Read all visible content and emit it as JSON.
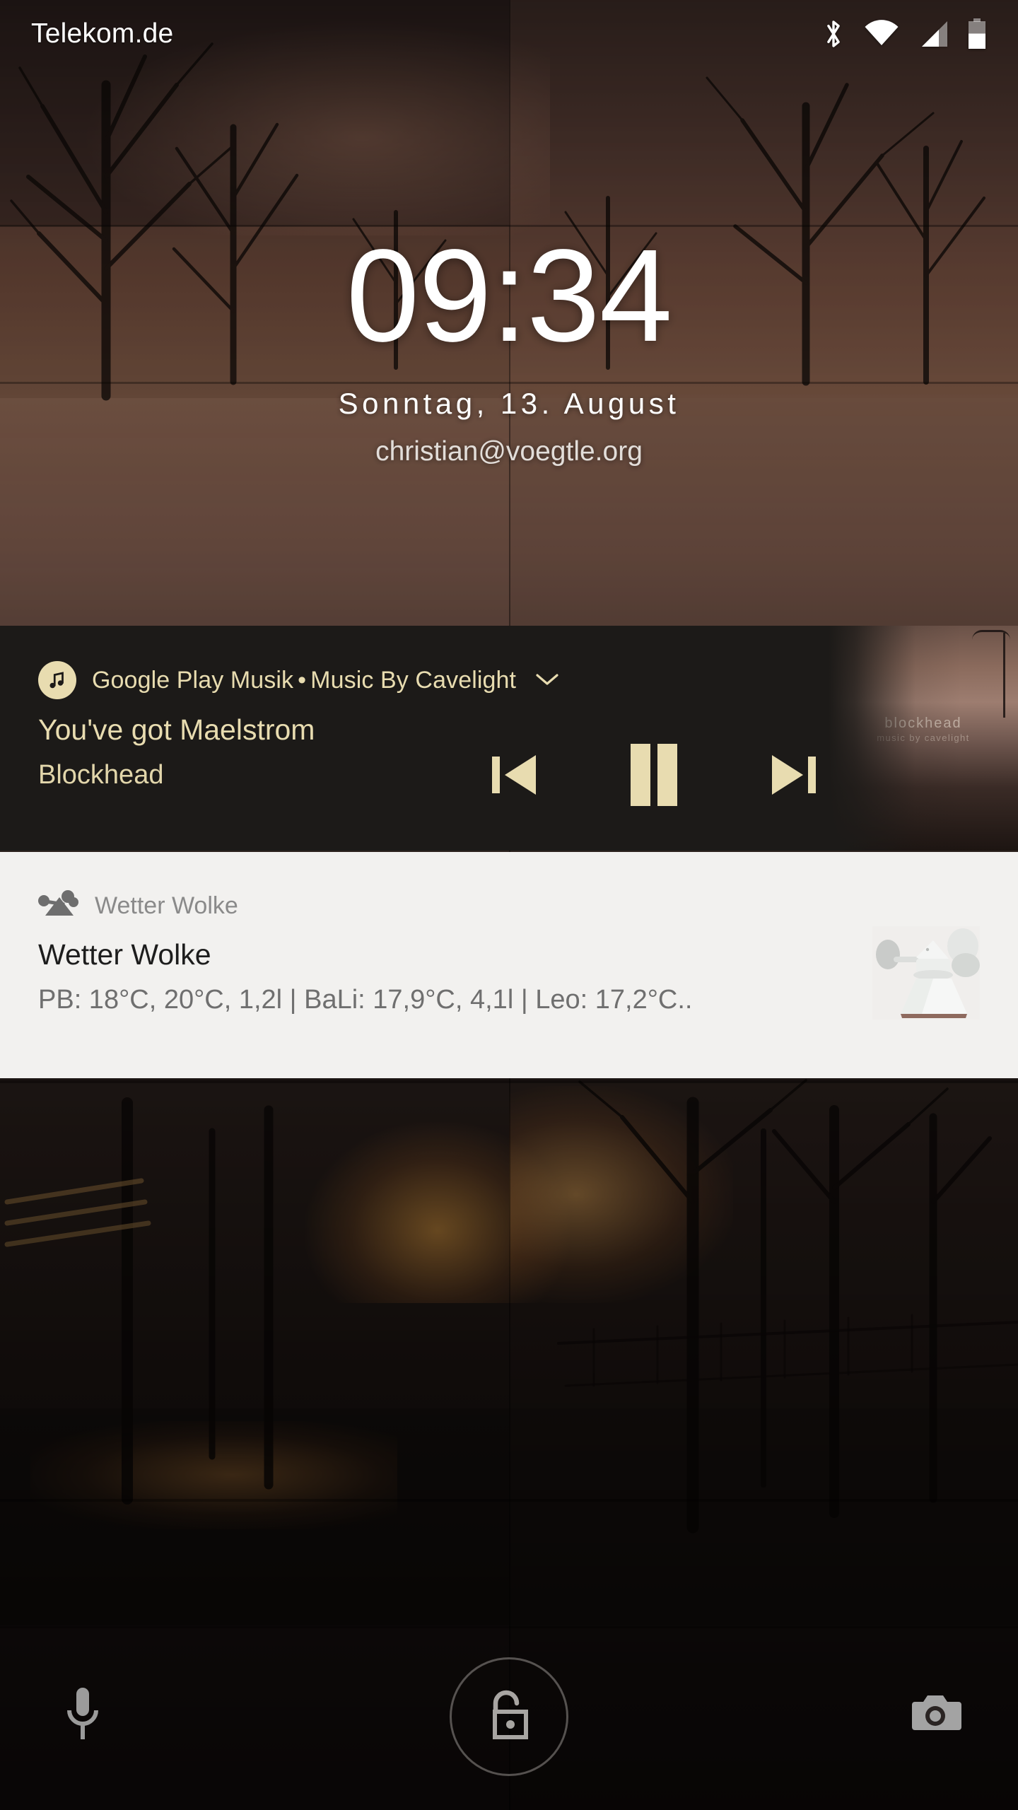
{
  "status_bar": {
    "carrier": "Telekom.de",
    "icons": [
      {
        "name": "bluetooth-icon",
        "state": "connected"
      },
      {
        "name": "wifi-icon",
        "state": "full"
      },
      {
        "name": "cellular-signal-icon",
        "state": "2-of-3-bars"
      },
      {
        "name": "battery-icon",
        "level_percent": 55
      }
    ]
  },
  "lock_screen": {
    "clock": "09:34",
    "date": "Sonntag, 13. August",
    "owner_info": "christian@voegtle.org"
  },
  "notifications": [
    {
      "id": "media",
      "app_name": "Google Play Musik",
      "separator": "•",
      "subtext": "Music By Cavelight",
      "expand_icon": "chevron-down-icon",
      "app_icon": "music-note-icon",
      "track_title": "You've got Maelstrom",
      "track_artist": "Blockhead",
      "album_art_title": "blockhead",
      "album_art_subtitle": "music by cavelight",
      "controls": [
        {
          "name": "previous-track-button",
          "label": "Previous"
        },
        {
          "name": "pause-button",
          "label": "Pause"
        },
        {
          "name": "next-track-button",
          "label": "Next"
        }
      ],
      "colors": {
        "background": "#1c1a18",
        "accent": "#e8dcb0"
      }
    },
    {
      "id": "weather",
      "app_name": "Wetter Wolke",
      "app_icon": "weather-station-icon",
      "title": "Wetter Wolke",
      "body": "PB: 18°C, 20°C, 1,2l | BaLi: 17,9°C, 4,1l | Leo: 17,2°C..",
      "thumbnail": "anemometer-photo",
      "colors": {
        "background": "#f2f1ef",
        "title": "#1d1d1d",
        "body": "#6f6f6f"
      }
    }
  ],
  "bottom_actions": [
    {
      "name": "voice-assist-button",
      "icon": "microphone-icon"
    },
    {
      "name": "unlock-button",
      "icon": "unlock-padlock-icon"
    },
    {
      "name": "camera-button",
      "icon": "camera-icon"
    }
  ],
  "theme": {
    "media_accent": "#e8dcb0",
    "media_background": "#1c1a18",
    "weather_background": "#f2f1ef",
    "status_icon_color": "#ffffff"
  }
}
